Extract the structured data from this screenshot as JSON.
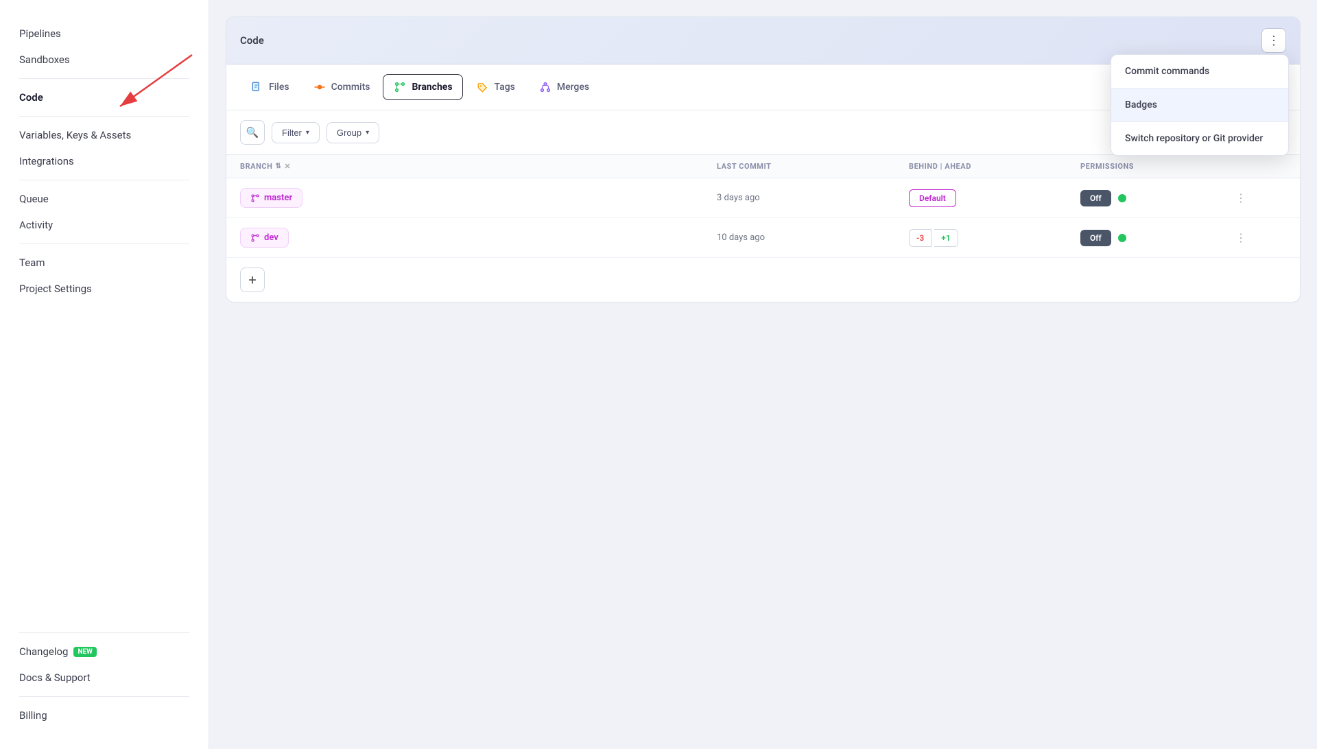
{
  "sidebar": {
    "items": [
      {
        "label": "Pipelines",
        "active": false
      },
      {
        "label": "Sandboxes",
        "active": false
      },
      {
        "label": "Code",
        "active": true
      },
      {
        "label": "Variables, Keys & Assets",
        "active": false
      },
      {
        "label": "Integrations",
        "active": false
      },
      {
        "label": "Queue",
        "active": false
      },
      {
        "label": "Activity",
        "active": false
      },
      {
        "label": "Team",
        "active": false
      },
      {
        "label": "Project Settings",
        "active": false
      }
    ],
    "bottom_items": [
      {
        "label": "Changelog",
        "badge": "NEW"
      },
      {
        "label": "Docs & Support"
      },
      {
        "label": "Billing"
      }
    ]
  },
  "header": {
    "title": "Code",
    "three_dot_label": "⋮"
  },
  "tabs": [
    {
      "label": "Files",
      "icon": "📄",
      "active": false
    },
    {
      "label": "Commits",
      "icon": "🔀",
      "active": false
    },
    {
      "label": "Branches",
      "icon": "🌿",
      "active": true
    },
    {
      "label": "Tags",
      "icon": "🏷️",
      "active": false
    },
    {
      "label": "Merges",
      "icon": "🔗",
      "active": false
    }
  ],
  "toolbar": {
    "filter_label": "Filter",
    "group_label": "Group"
  },
  "table": {
    "columns": [
      {
        "label": "BRANCH",
        "sortable": true,
        "clearable": true
      },
      {
        "label": "LAST COMMIT",
        "sortable": false
      },
      {
        "label": "BEHIND | AHEAD",
        "sortable": false
      },
      {
        "label": "PERMISSIONS",
        "sortable": false
      },
      {
        "label": "",
        "sortable": false
      }
    ],
    "rows": [
      {
        "branch": "master",
        "last_commit": "3 days ago",
        "status": "default",
        "default_label": "Default",
        "permissions_off": "Off",
        "active": true
      },
      {
        "branch": "dev",
        "last_commit": "10 days ago",
        "status": "behind_ahead",
        "behind": "-3",
        "ahead": "+1",
        "permissions_off": "Off",
        "active": true
      }
    ]
  },
  "dropdown": {
    "items": [
      {
        "label": "Commit commands",
        "highlighted": false
      },
      {
        "label": "Badges",
        "highlighted": true
      },
      {
        "label": "Switch repository or Git provider",
        "highlighted": false
      }
    ]
  },
  "add_button_label": "+"
}
